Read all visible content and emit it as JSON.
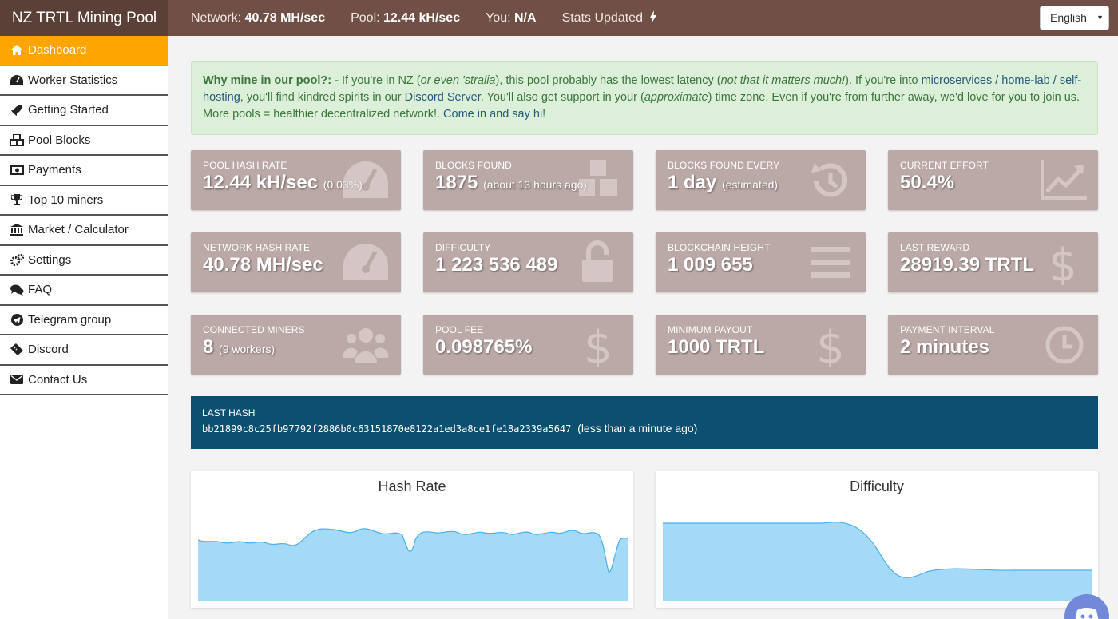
{
  "header": {
    "brand": "NZ TRTL Mining Pool",
    "network_label": "Network:",
    "network_value": "40.78 MH/sec",
    "pool_label": "Pool:",
    "pool_value": "12.44 kH/sec",
    "you_label": "You:",
    "you_value": "N/A",
    "stats_updated": "Stats Updated",
    "language": "English"
  },
  "sidebar": {
    "items": [
      {
        "label": "Dashboard",
        "icon": "home-icon"
      },
      {
        "label": "Worker Statistics",
        "icon": "tachometer-icon"
      },
      {
        "label": "Getting Started",
        "icon": "rocket-icon"
      },
      {
        "label": "Pool Blocks",
        "icon": "cubes-icon"
      },
      {
        "label": "Payments",
        "icon": "money-icon"
      },
      {
        "label": "Top 10 miners",
        "icon": "trophy-icon"
      },
      {
        "label": "Market / Calculator",
        "icon": "bank-icon"
      },
      {
        "label": "Settings",
        "icon": "cogs-icon"
      },
      {
        "label": "FAQ",
        "icon": "comments-icon"
      },
      {
        "label": "Telegram group",
        "icon": "telegram-icon"
      },
      {
        "label": "Discord",
        "icon": "ticket-icon"
      },
      {
        "label": "Contact Us",
        "icon": "envelope-icon"
      }
    ]
  },
  "notice": {
    "lead": "Why mine in our pool?:",
    "t1": " - If you're in NZ (",
    "i1": "or even 'stralia",
    "t2": "), this pool probably has the lowest latency (",
    "i2": "not that it matters much!",
    "t3": "). If you're into ",
    "link1": "microservices / home-lab / self-hosting",
    "t4": ", you'll find kindred spirits in our ",
    "link2": "Discord Server",
    "t5": ". You'll also get support in your (",
    "i3": "approximate",
    "t6": ") time zone. Even if you're from further away, we'd love for you to join us. More pools = healthier decentralized network!. ",
    "link3": "Come in and say hi",
    "t7": "!"
  },
  "cards": {
    "pool_hash": {
      "label": "Pool Hash Rate",
      "value": "12.44 kH/sec",
      "note": "(0.03%)"
    },
    "blocks_found": {
      "label": "Blocks Found",
      "value": "1875",
      "note": "(about 13 hours ago)"
    },
    "blocks_every": {
      "label": "Blocks Found Every",
      "value": "1 day",
      "note": "(estimated)"
    },
    "effort": {
      "label": "Current Effort",
      "value": "50.4%"
    },
    "network_hash": {
      "label": "Network Hash Rate",
      "value": "40.78 MH/sec"
    },
    "difficulty": {
      "label": "Difficulty",
      "value": "1 223 536 489"
    },
    "height": {
      "label": "Blockchain Height",
      "value": "1 009 655"
    },
    "last_reward": {
      "label": "Last Reward",
      "value": "28919.39 TRTL"
    },
    "miners": {
      "label": "Connected Miners",
      "value": "8",
      "note": "(9 workers)"
    },
    "fee": {
      "label": "Pool Fee",
      "value": "0.098765%"
    },
    "min_payout": {
      "label": "Minimum Payout",
      "value": "1000 TRTL"
    },
    "interval": {
      "label": "Payment Interval",
      "value": "2 minutes"
    }
  },
  "last_hash": {
    "label": "LAST HASH",
    "hash": "bb21899c8c25fb97792f2886b0c63151870e8122a1ed3a8ce1fe18a2339a5647",
    "ago": "(less than a minute ago)"
  },
  "charts": {
    "hash_title": "Hash Rate",
    "diff_title": "Difficulty"
  },
  "colors": {
    "topbar": "#705046",
    "active_nav": "#ffa500",
    "card": "#bba9a7",
    "hash_panel": "#0d4f70",
    "chart_fill": "#a4d9f8",
    "chart_line": "#45b0ee"
  }
}
